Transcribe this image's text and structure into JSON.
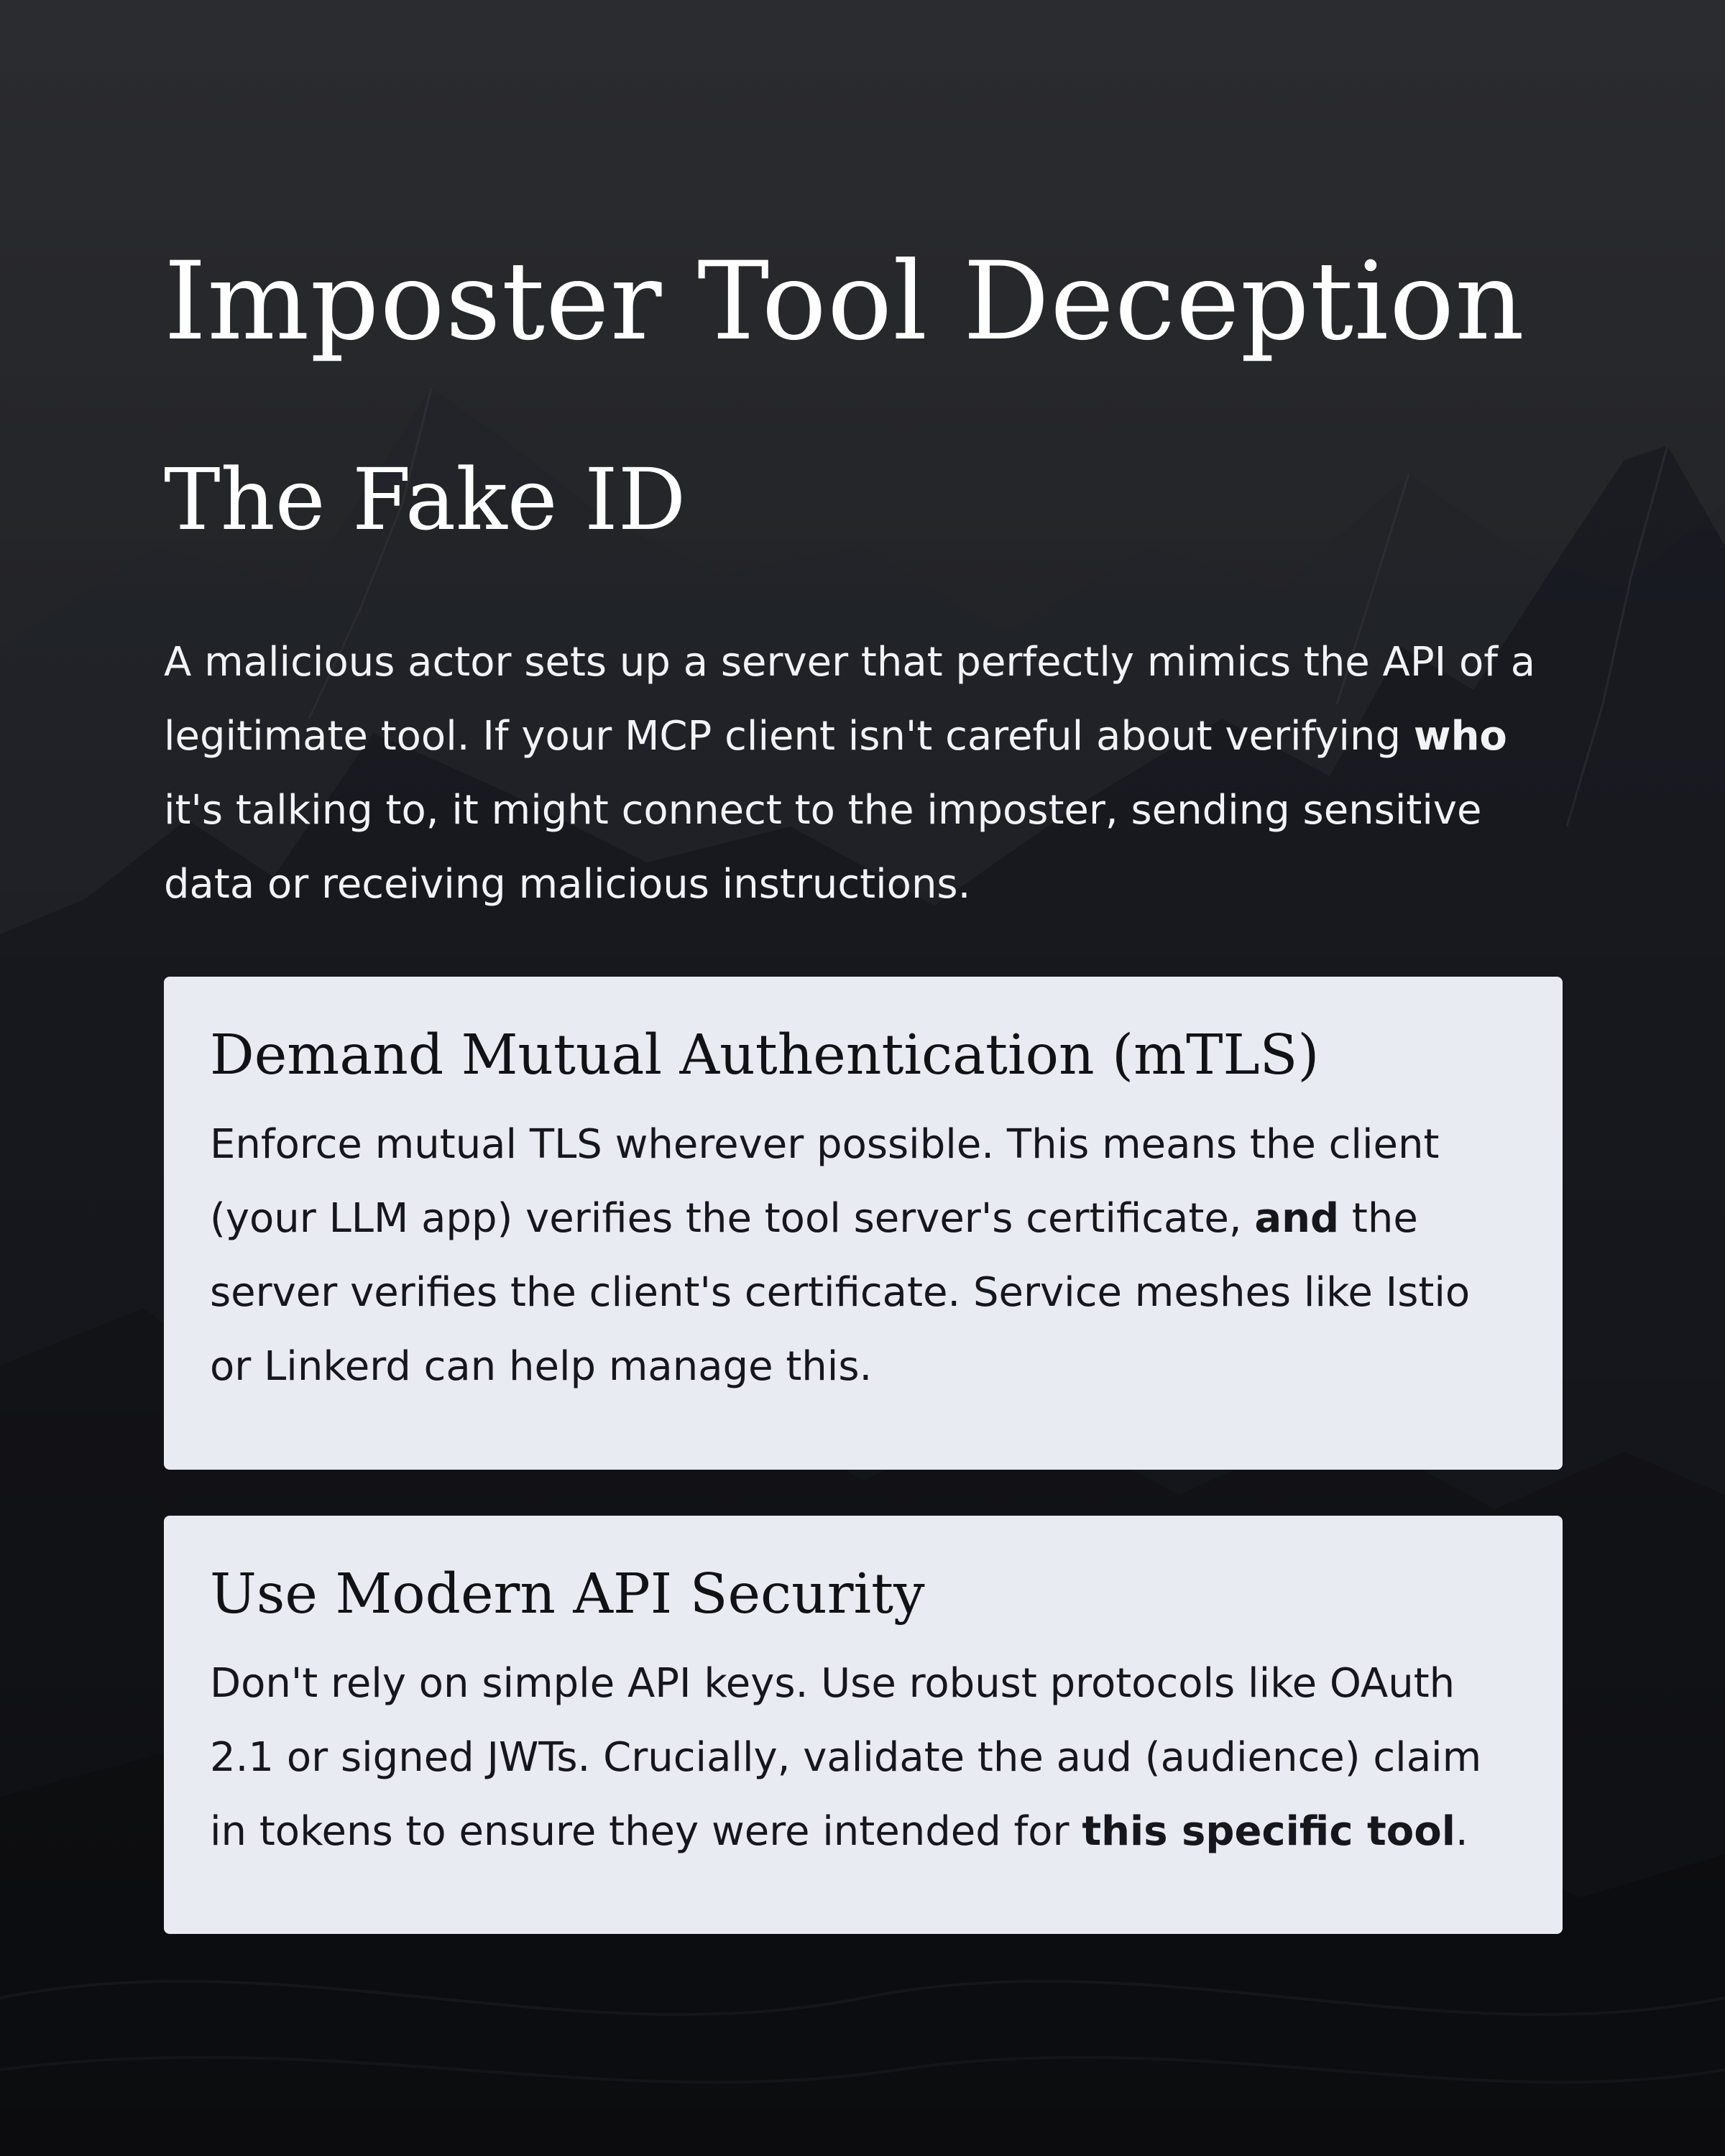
{
  "page": {
    "title": "Imposter Tool Deception",
    "subtitle": "The Fake ID"
  },
  "intro": {
    "part1": "A malicious actor sets up a server that perfectly mimics the API of a legitimate tool. If your MCP client isn't careful about verifying ",
    "bold": "who",
    "part2": " it's talking to, it might connect to the imposter, sending sensitive data or receiving malicious instructions."
  },
  "cards": [
    {
      "title": "Demand Mutual Authentication (mTLS)",
      "body_part1": "Enforce mutual TLS wherever possible. This means the client (your LLM app) verifies the tool server's certificate, ",
      "body_bold": "and",
      "body_part2": " the server verifies the client's certificate. Service meshes like Istio or Linkerd can help manage this."
    },
    {
      "title": "Use Modern API Security",
      "body_part1": "Don't rely on simple API keys. Use robust protocols like OAuth 2.1 or signed JWTs. Crucially, validate the aud (audience) claim in tokens to ensure they were intended for ",
      "body_bold": "this specific tool",
      "body_part2": "."
    }
  ],
  "colors": {
    "background": "#1d1e22",
    "card_background": "#e9ebf2",
    "heading_text": "#ffffff",
    "card_text": "#101216"
  },
  "background_image": {
    "icon": "mountain-range-icon"
  }
}
